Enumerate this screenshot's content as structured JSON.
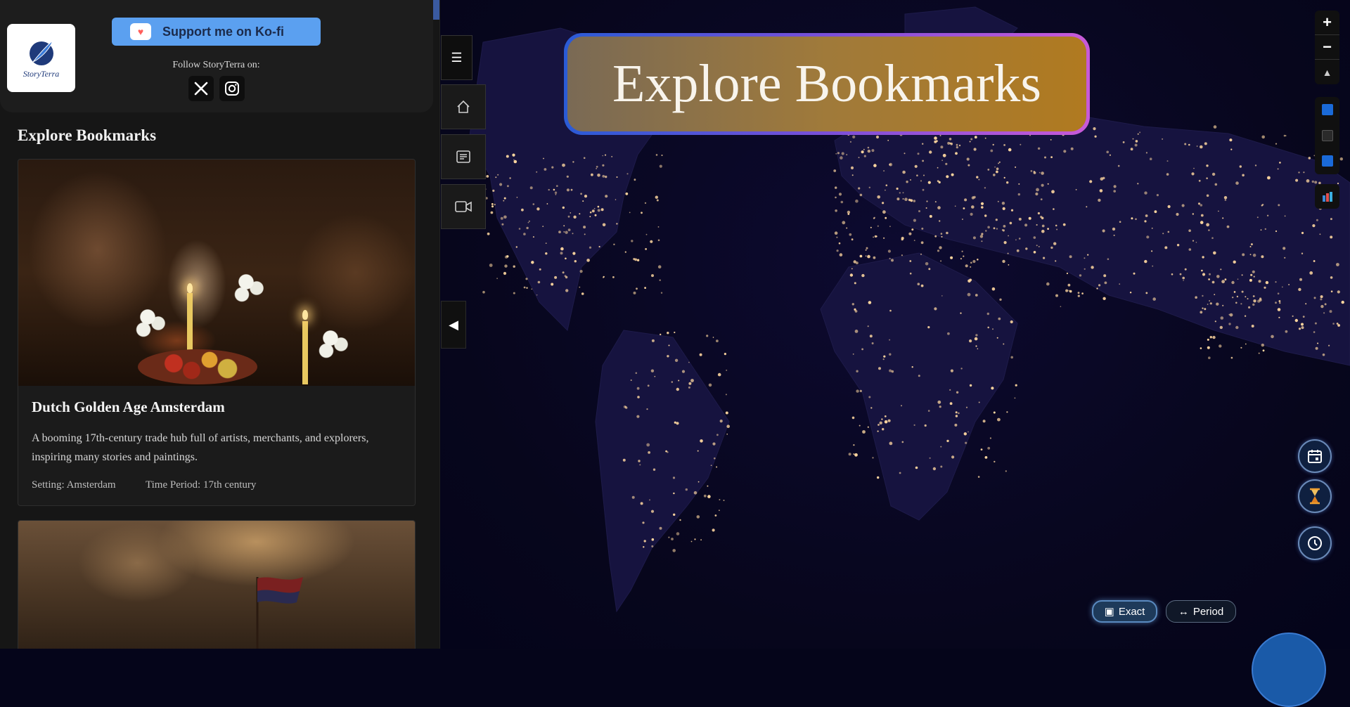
{
  "sidebar": {
    "kofi_label": "Support me on Ko-fi",
    "logo_text": "StoryTerra",
    "follow_text": "Follow StoryTerra on:",
    "social": [
      {
        "icon": "x-icon",
        "label": "X"
      },
      {
        "icon": "instagram-icon",
        "label": "Instagram"
      }
    ],
    "section_title": "Explore Bookmarks",
    "cards": [
      {
        "title": "Dutch Golden Age Amsterdam",
        "description": "A booming 17th-century trade hub full of artists, merchants, and explorers, inspiring many stories and paintings.",
        "setting": "Setting: Amsterdam",
        "period": "Time Period: 17th century"
      },
      {
        "title": "",
        "description": "",
        "setting": "",
        "period": ""
      }
    ]
  },
  "toolbar": {
    "menu_icon": "hamburger-icon",
    "items": [
      {
        "icon": "home-icon"
      },
      {
        "icon": "document-icon"
      },
      {
        "icon": "video-icon"
      }
    ],
    "collapse_icon": "collapse-left-icon"
  },
  "map": {
    "banner_title": "Explore Bookmarks",
    "controls": {
      "zoom_in": "+",
      "zoom_out": "−",
      "compass": "▲"
    },
    "round_buttons": [
      {
        "icon": "calendar-icon"
      },
      {
        "icon": "hourglass-icon"
      },
      {
        "icon": "clock-icon"
      }
    ],
    "mode_buttons": {
      "exact": "Exact",
      "period": "Period"
    }
  },
  "colors": {
    "sidebar_bg": "#161616",
    "map_bg": "#07061c",
    "banner_border_start": "#2a5bd6",
    "banner_border_end": "#c85ad8",
    "banner_fill": "#a07a3a",
    "kofi_button": "#5ba0f0",
    "accent_blue": "#1a5aa8"
  }
}
